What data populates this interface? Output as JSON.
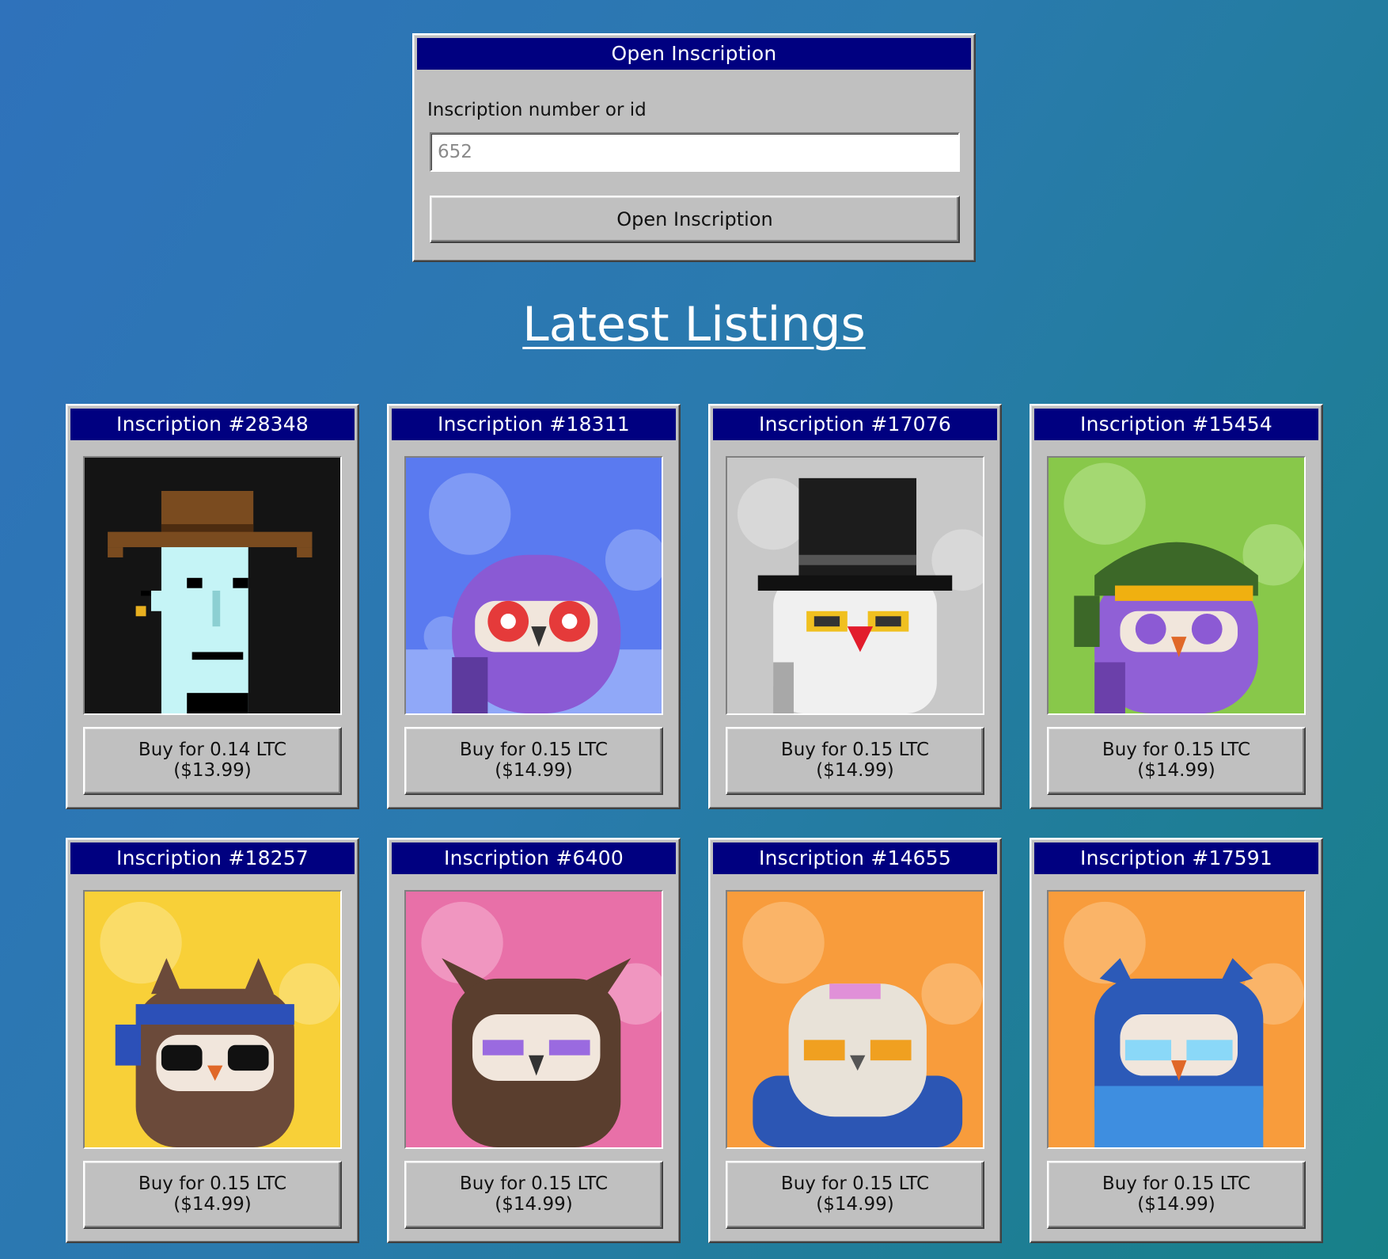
{
  "open_dialog": {
    "title": "Open Inscription",
    "field_label": "Inscription number or id",
    "input_placeholder": "652",
    "button_label": "Open Inscription"
  },
  "heading": "Latest Listings",
  "listings": [
    {
      "title": "Inscription #28348",
      "price_ltc": "Buy for 0.14 LTC",
      "price_usd": "($13.99)",
      "art": "punk-cowboy-hat"
    },
    {
      "title": "Inscription #18311",
      "price_ltc": "Buy for 0.15 LTC",
      "price_usd": "($14.99)",
      "art": "purple-owl-red-eyes"
    },
    {
      "title": "Inscription #17076",
      "price_ltc": "Buy for 0.15 LTC",
      "price_usd": "($14.99)",
      "art": "white-owl-top-hat"
    },
    {
      "title": "Inscription #15454",
      "price_ltc": "Buy for 0.15 LTC",
      "price_usd": "($14.99)",
      "art": "purple-owl-green-cap"
    },
    {
      "title": "Inscription #18257",
      "price_ltc": "Buy for 0.15 LTC",
      "price_usd": "($14.99)",
      "art": "brown-owl-bandana-sunglasses"
    },
    {
      "title": "Inscription #6400",
      "price_ltc": "Buy for 0.15 LTC",
      "price_usd": "($14.99)",
      "art": "brown-owl-purple-eyes"
    },
    {
      "title": "Inscription #14655",
      "price_ltc": "Buy for 0.15 LTC",
      "price_usd": "($14.99)",
      "art": "white-owl-blue-hoodie"
    },
    {
      "title": "Inscription #17591",
      "price_ltc": "Buy for 0.15 LTC",
      "price_usd": "($14.99)",
      "art": "blue-owl-blue-glasses"
    }
  ],
  "colors": {
    "titlebar": "#000080",
    "window": "#c0c0c0",
    "card_backgrounds": [
      "#141414",
      "#5a7af0",
      "#c8c8c8",
      "#88c84a",
      "#f8d038",
      "#e870a8",
      "#f89c3c",
      "#f89c3c"
    ]
  }
}
